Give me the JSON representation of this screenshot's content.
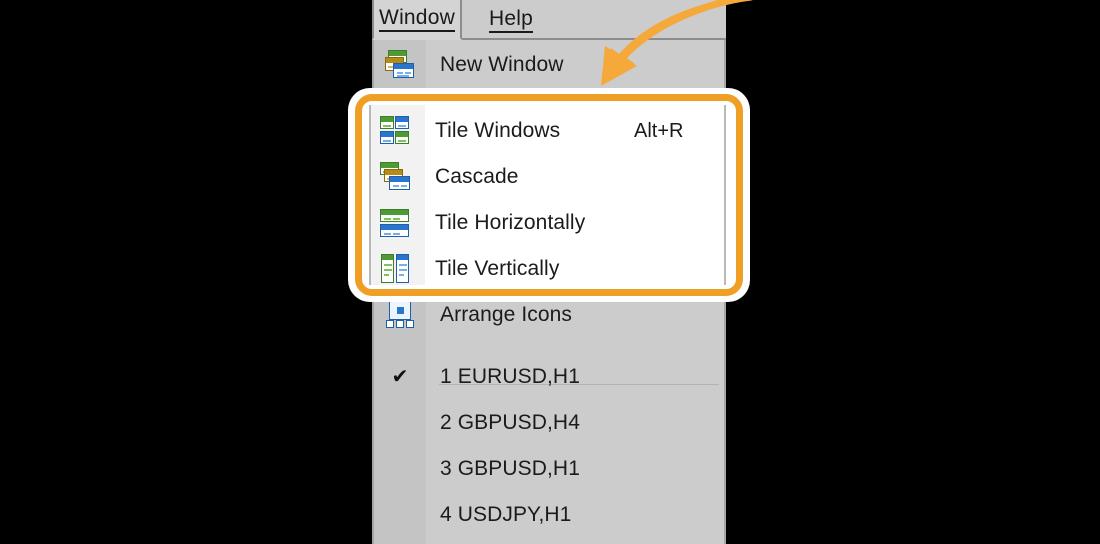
{
  "colors": {
    "accent_orange": "#ef9f26",
    "menu_bg": "#cccccc",
    "gutter_bg": "#c4c4c4",
    "highlight_bg": "#ffffff",
    "text": "#1b1b1b",
    "icon_green": "#4f9b33",
    "icon_blue": "#2a76cf",
    "icon_orange": "#b68c14"
  },
  "menubar": {
    "tabs": [
      {
        "label": "Window",
        "active": true
      },
      {
        "label": "Help",
        "active": false
      }
    ]
  },
  "dropdown": {
    "items": [
      {
        "label": "New Window",
        "accel": "",
        "icon": "new-window-icon",
        "checked": false
      },
      {
        "label": "Tile Windows",
        "accel": "Alt+R",
        "icon": "tile-windows-icon",
        "checked": false
      },
      {
        "label": "Cascade",
        "accel": "",
        "icon": "cascade-icon",
        "checked": false
      },
      {
        "label": "Tile Horizontally",
        "accel": "",
        "icon": "tile-horizontally-icon",
        "checked": false
      },
      {
        "label": "Tile Vertically",
        "accel": "",
        "icon": "tile-vertically-icon",
        "checked": false
      },
      {
        "label": "Arrange Icons",
        "accel": "",
        "icon": "arrange-icons-icon",
        "checked": false
      }
    ],
    "window_list": [
      {
        "label": "1 EURUSD,H1",
        "checked": true
      },
      {
        "label": "2 GBPUSD,H4",
        "checked": false
      },
      {
        "label": "3 GBPUSD,H1",
        "checked": false
      },
      {
        "label": "4 USDJPY,H1",
        "checked": false
      }
    ],
    "check_glyph": "✔"
  },
  "callout": {
    "items": [
      {
        "label": "Tile Windows",
        "accel": "Alt+R",
        "icon": "tile-windows-icon"
      },
      {
        "label": "Cascade",
        "accel": "",
        "icon": "cascade-icon"
      },
      {
        "label": "Tile Horizontally",
        "accel": "",
        "icon": "tile-horizontally-icon"
      },
      {
        "label": "Tile Vertically",
        "accel": "",
        "icon": "tile-vertically-icon"
      }
    ]
  }
}
